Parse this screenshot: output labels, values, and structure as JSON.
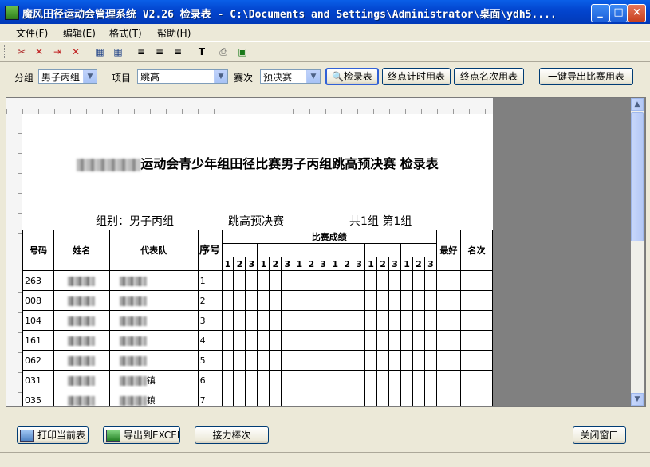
{
  "window": {
    "title": "魔风田径运动会管理系统 V2.26 检录表  - C:\\Documents and Settings\\Administrator\\桌面\\ydh5....",
    "min": "_",
    "max": "□",
    "close": "×"
  },
  "menu": [
    "文件(F)",
    "编辑(E)",
    "格式(T)",
    "帮助(H)"
  ],
  "toolbar_icons": [
    "cut-icon",
    "delete-icon",
    "delete-row-icon",
    "delete-col-icon",
    "table-icon",
    "grid-icon",
    "align-left-icon",
    "align-center-icon",
    "align-right-icon",
    "text-icon",
    "print-icon",
    "excel-icon"
  ],
  "filters": {
    "group_label": "分组",
    "group_value": "男子丙组",
    "event_label": "项目",
    "event_value": "跳高",
    "round_label": "赛次",
    "round_value": "预决赛"
  },
  "buttons": {
    "checkin": "检录表",
    "timing": "终点计时用表",
    "ranking": "终点名次用表",
    "export_all": "一键导出比赛用表"
  },
  "report": {
    "title_suffix": "运动会青少年组田径比赛男子丙组跳高预决赛 检录表",
    "group_info": "组别：男子丙组",
    "event_info": "跳高预决赛",
    "page_info": "共1组  第1组",
    "headers": {
      "num": "号码",
      "name": "姓名",
      "team": "代表队",
      "order": "序号",
      "results": "比赛成绩",
      "best": "最好",
      "rank": "名次"
    },
    "trial_labels": [
      "1",
      "2",
      "3",
      "1",
      "2",
      "3",
      "1",
      "2",
      "3",
      "1",
      "2",
      "3",
      "1",
      "2",
      "3",
      "1",
      "2",
      "3"
    ],
    "rows": [
      {
        "num": "263",
        "team_suffix": "",
        "order": "1"
      },
      {
        "num": "008",
        "team_suffix": "",
        "order": "2"
      },
      {
        "num": "104",
        "team_suffix": "",
        "order": "3"
      },
      {
        "num": "161",
        "team_suffix": "",
        "order": "4"
      },
      {
        "num": "062",
        "team_suffix": "",
        "order": "5"
      },
      {
        "num": "031",
        "team_suffix": "镇",
        "order": "6"
      },
      {
        "num": "035",
        "team_suffix": "镇",
        "order": "7"
      }
    ]
  },
  "bottom_buttons": {
    "print": "打印当前表",
    "export_excel": "导出到EXCEL",
    "relay": "接力棒次",
    "close": "关闭窗口"
  }
}
